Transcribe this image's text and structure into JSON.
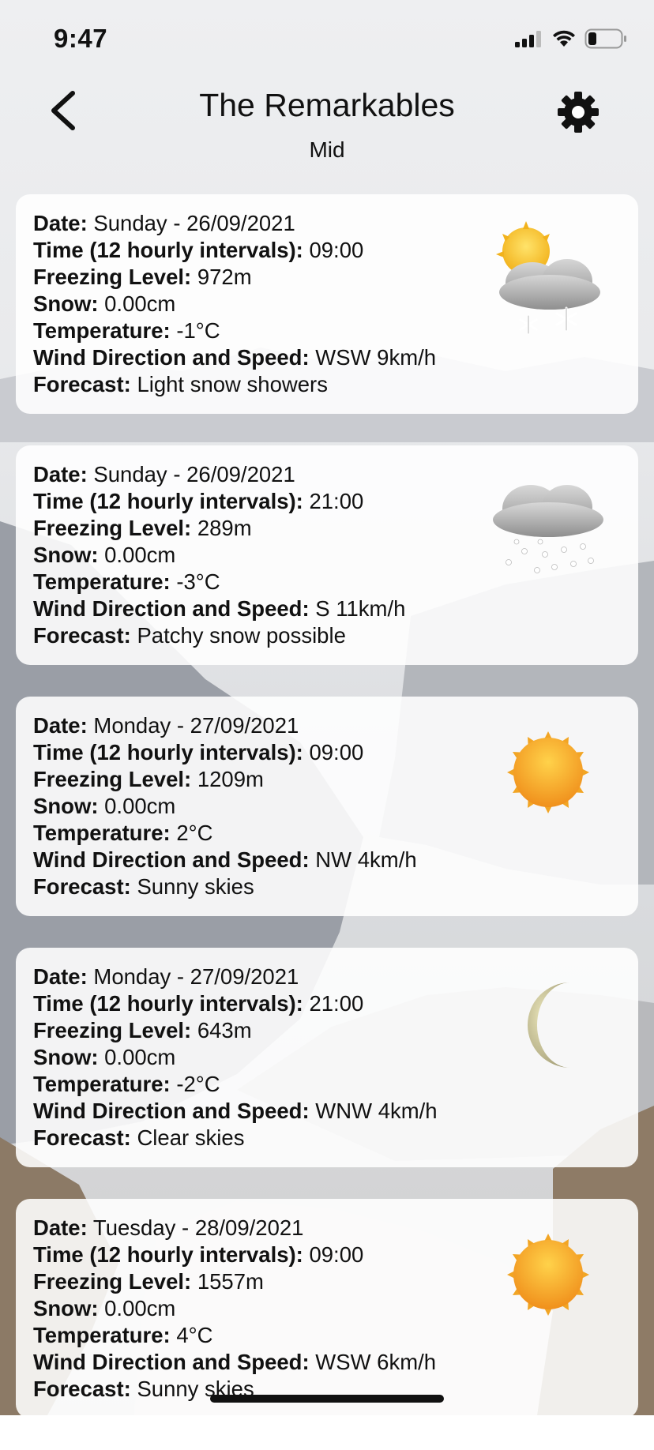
{
  "status": {
    "time": "9:47"
  },
  "header": {
    "title": "The Remarkables",
    "subtitle": "Mid"
  },
  "labels": {
    "date": "Date:",
    "time": "Time (12 hourly intervals):",
    "freezing": "Freezing Level:",
    "snow": "Snow:",
    "temperature": "Temperature:",
    "wind": "Wind Direction and Speed:",
    "forecast": "Forecast:"
  },
  "forecasts": [
    {
      "date": "Sunday - 26/09/2021",
      "time": "09:00",
      "freezing": "972m",
      "snow": "0.00cm",
      "temperature": "-1°C",
      "wind": "WSW 9km/h",
      "forecast": "Light snow showers",
      "icon": "sun-cloud-snow-icon"
    },
    {
      "date": "Sunday - 26/09/2021",
      "time": "21:00",
      "freezing": "289m",
      "snow": "0.00cm",
      "temperature": "-3°C",
      "wind": "S 11km/h",
      "forecast": "Patchy snow possible",
      "icon": "cloud-snow-icon"
    },
    {
      "date": "Monday - 27/09/2021",
      "time": "09:00",
      "freezing": "1209m",
      "snow": "0.00cm",
      "temperature": "2°C",
      "wind": "NW 4km/h",
      "forecast": "Sunny skies",
      "icon": "sun-icon"
    },
    {
      "date": "Monday - 27/09/2021",
      "time": "21:00",
      "freezing": "643m",
      "snow": "0.00cm",
      "temperature": "-2°C",
      "wind": "WNW 4km/h",
      "forecast": "Clear skies",
      "icon": "moon-icon"
    },
    {
      "date": "Tuesday - 28/09/2021",
      "time": "09:00",
      "freezing": "1557m",
      "snow": "0.00cm",
      "temperature": "4°C",
      "wind": "WSW 6km/h",
      "forecast": "Sunny skies",
      "icon": "sun-icon"
    }
  ]
}
